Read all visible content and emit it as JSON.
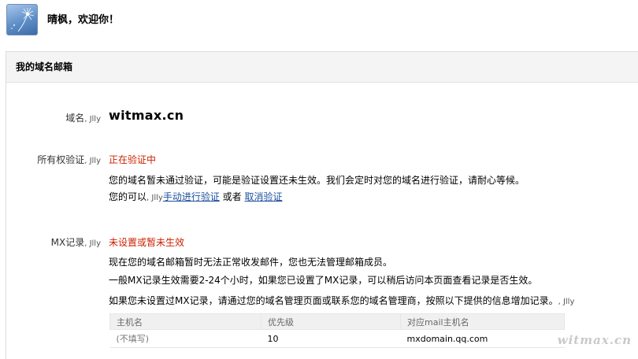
{
  "header": {
    "greeting": "晴枫，欢迎你！"
  },
  "panel": {
    "title": "我的域名邮箱"
  },
  "domain": {
    "label": "域名",
    "mark": "Jlly",
    "value": "witmax.cn"
  },
  "ownership": {
    "label": "所有权验证",
    "mark": "Jlly",
    "status": "正在验证中",
    "desc": "您的域名暂未通过验证，可能是验证设置还未生效。我们会定时对您的域名进行验证，请耐心等候。",
    "action_prefix": "您的可以",
    "action_mark": "Jlly",
    "manual_link": "手动进行验证",
    "or_text": "或者",
    "cancel_link": "取消验证"
  },
  "mx": {
    "label": "MX记录",
    "mark": "Jlly",
    "status": "未设置或暂未生效",
    "line1": "现在您的域名邮箱暂时无法正常收发邮件，您也无法管理邮箱成员。",
    "line2": "一般MX记录生效需要2-24个小时，如果您已设置了MX记录，可以稍后访问本页面查看记录是否生效。",
    "line3": "如果您未设置过MX记录，请通过您的域名管理页面或联系您的域名管理商，按照以下提供的信息增加记录。",
    "line3_mark": "Jlly",
    "table": {
      "headers": [
        "主机名",
        "优先级",
        "对应mail主机名"
      ],
      "rows": [
        {
          "host": "(不填写)",
          "priority": "10",
          "mail_host": "mxdomain.qq.com"
        }
      ]
    }
  },
  "watermark": "witmax.cn",
  "colors": {
    "status_red": "#cc2200",
    "link_blue": "#1d4f9e"
  }
}
